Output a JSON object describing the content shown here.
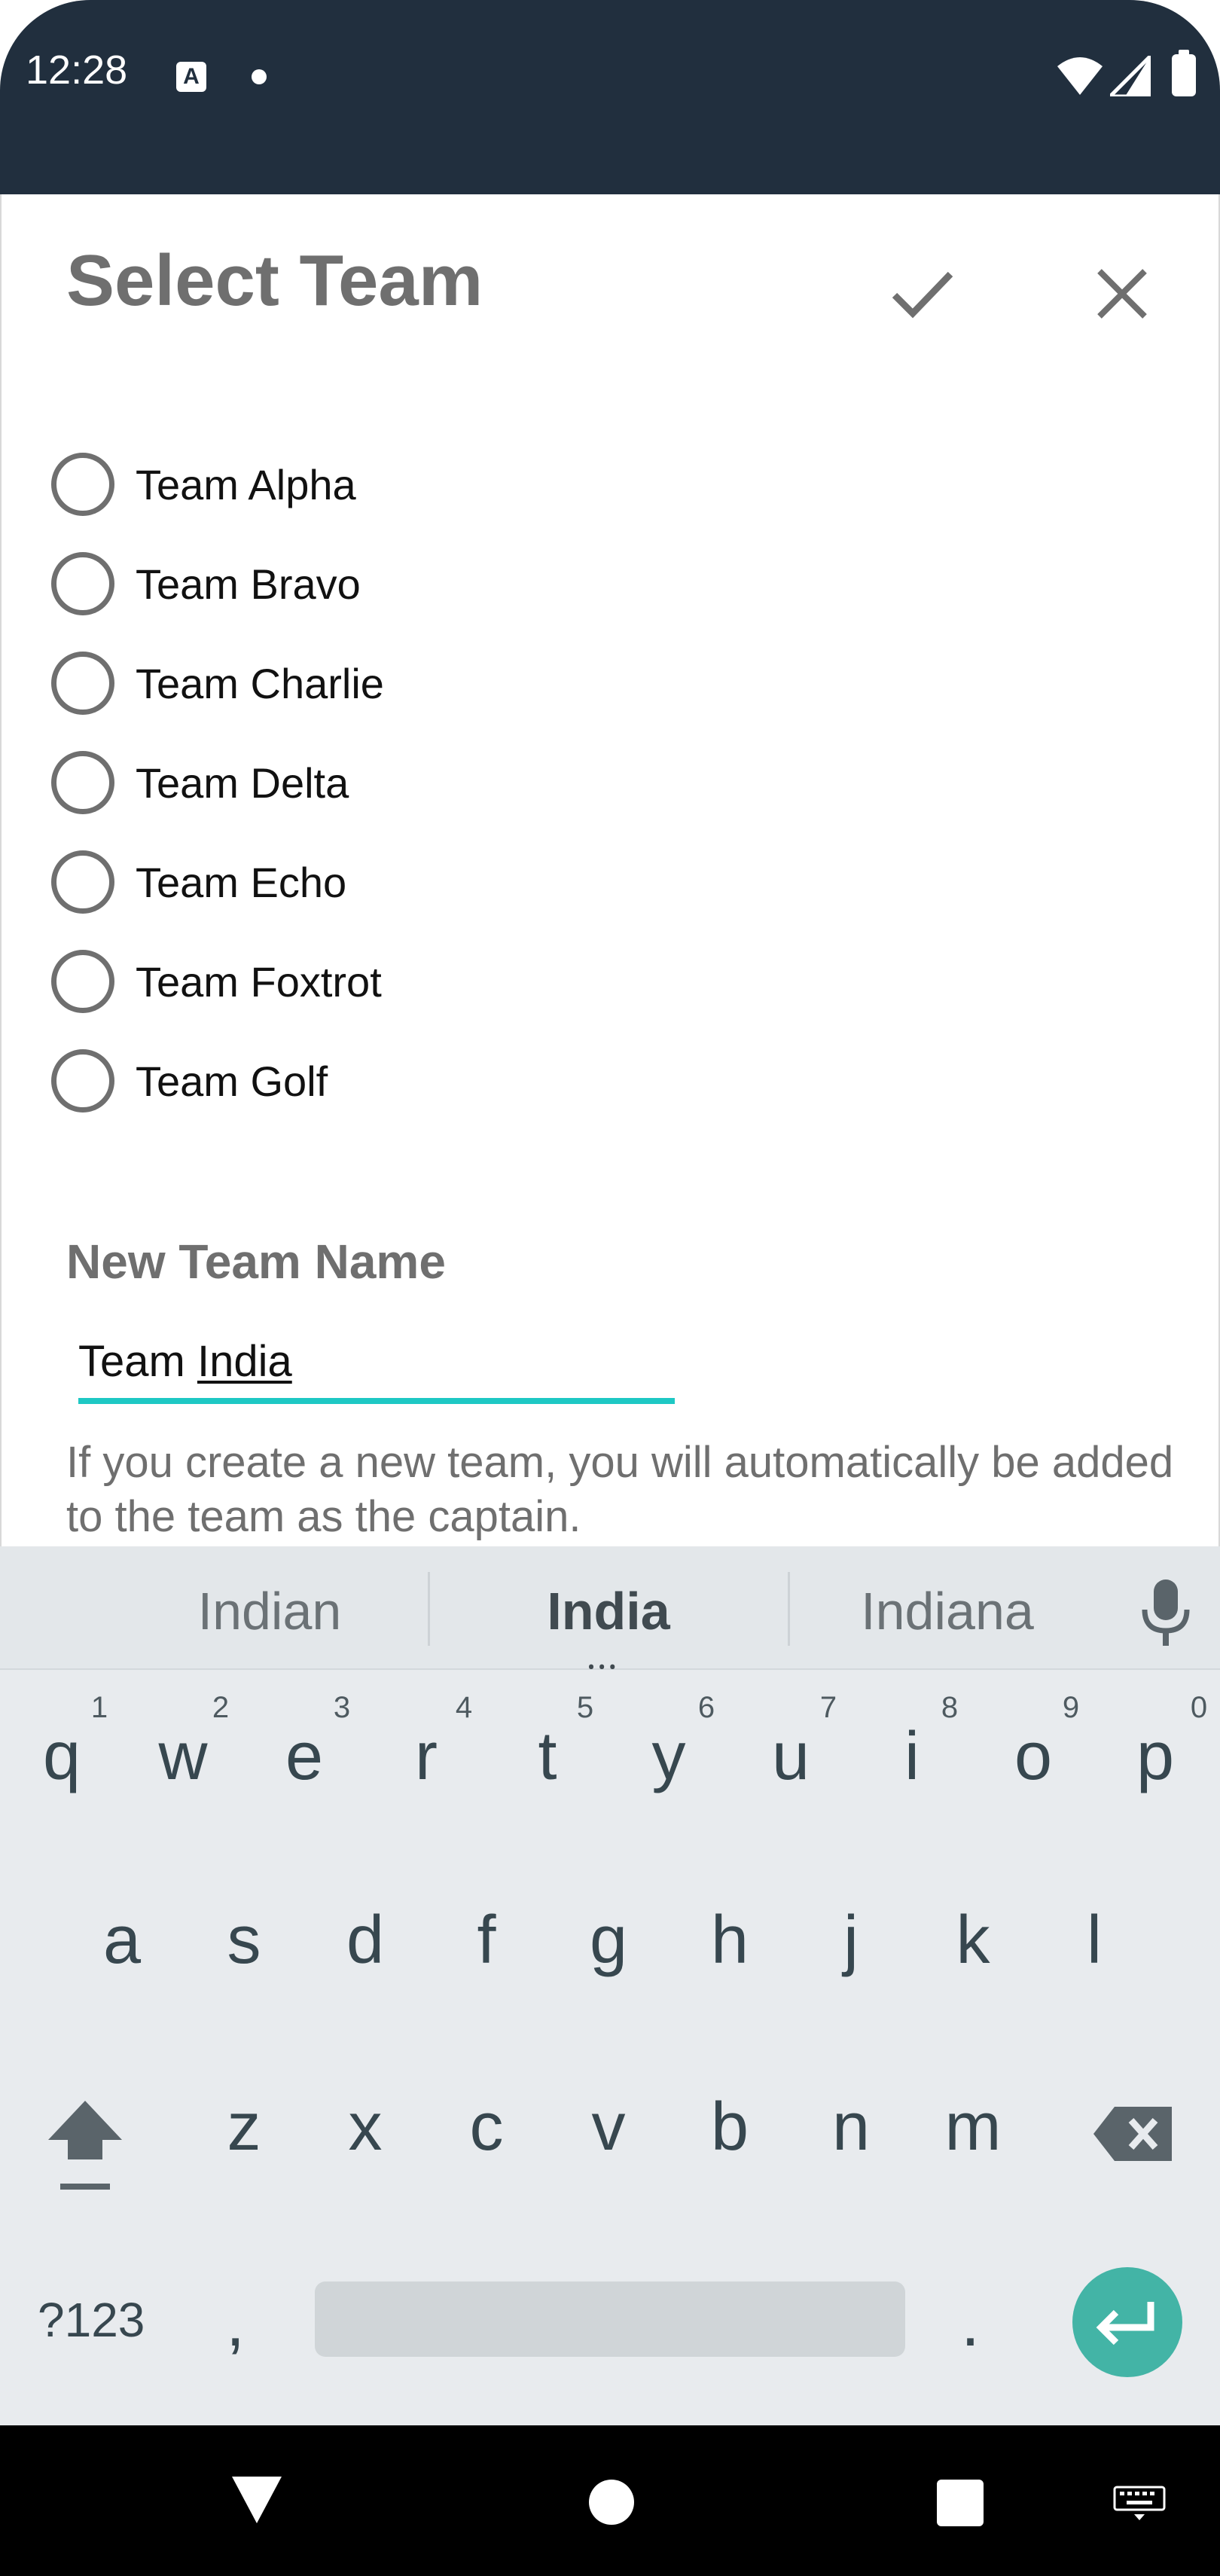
{
  "status_bar": {
    "time": "12:28",
    "notification_icons": [
      "text-a-icon",
      "dot-icon"
    ],
    "system_icons": [
      "wifi-icon",
      "signal-icon",
      "battery-icon"
    ]
  },
  "dialog": {
    "title": "Select Team",
    "confirm_icon": "check-icon",
    "close_icon": "close-icon",
    "teams": [
      {
        "label": "Team Alpha",
        "selected": false
      },
      {
        "label": "Team Bravo",
        "selected": false
      },
      {
        "label": "Team Charlie",
        "selected": false
      },
      {
        "label": "Team Delta",
        "selected": false
      },
      {
        "label": "Team Echo",
        "selected": false
      },
      {
        "label": "Team Foxtrot",
        "selected": false
      },
      {
        "label": "Team Golf",
        "selected": false
      }
    ],
    "new_team": {
      "label": "New Team Name",
      "value_prefix": "Team ",
      "value_composing": "India",
      "helper": "If you create a new team, you will automatically be added to the team as the captain."
    }
  },
  "keyboard": {
    "suggestions": [
      "Indian",
      "India",
      "Indiana"
    ],
    "row1": [
      "q",
      "w",
      "e",
      "r",
      "t",
      "y",
      "u",
      "i",
      "o",
      "p"
    ],
    "row1_hints": [
      "1",
      "2",
      "3",
      "4",
      "5",
      "6",
      "7",
      "8",
      "9",
      "0"
    ],
    "row2": [
      "a",
      "s",
      "d",
      "f",
      "g",
      "h",
      "j",
      "k",
      "l"
    ],
    "row3": [
      "z",
      "x",
      "c",
      "v",
      "b",
      "n",
      "m"
    ],
    "symbols_key": "?123",
    "comma_key": ",",
    "period_key": ".",
    "accent_color": "#43b4a6"
  },
  "colors": {
    "status_bar": "#212f3e",
    "input_underline": "#1ec8c4"
  }
}
